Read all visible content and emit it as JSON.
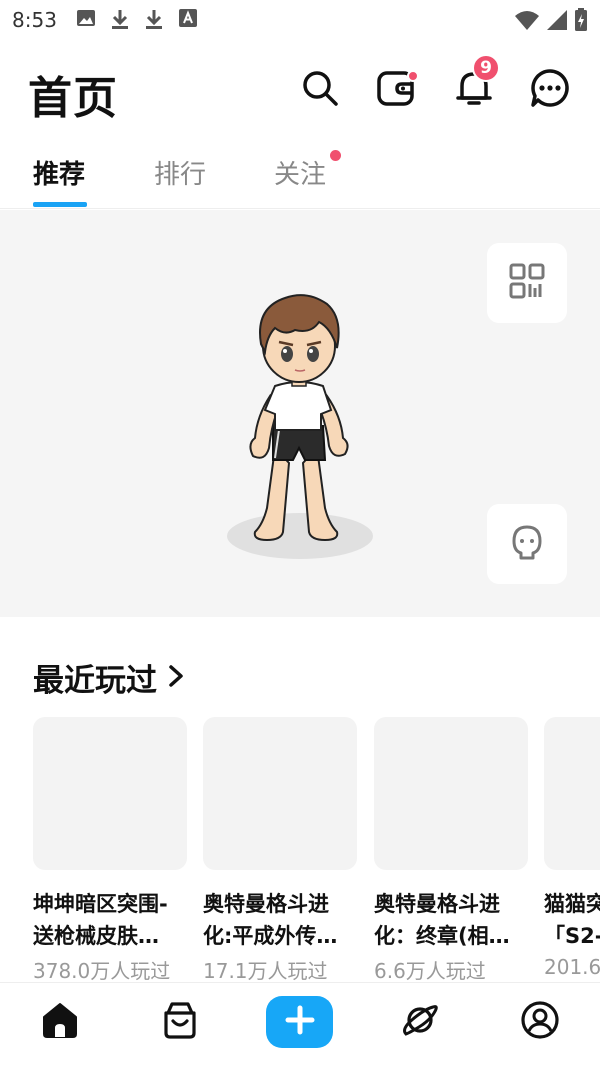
{
  "status": {
    "time": "8:53"
  },
  "header": {
    "title": "首页",
    "notification_count": "9"
  },
  "tabs": [
    {
      "label": "推荐",
      "active": true
    },
    {
      "label": "排行",
      "active": false
    },
    {
      "label": "关注",
      "active": false
    }
  ],
  "recent": {
    "title": "最近玩过",
    "items": [
      {
        "line1": "坤坤暗区突围-",
        "line2": "送枪械皮肤…",
        "plays": "378.0万人玩过"
      },
      {
        "line1": "奥特曼格斗进",
        "line2": "化:平成外传…",
        "plays": "17.1万人玩过"
      },
      {
        "line1": "奥特曼格斗进",
        "line2": "化：终章(相…",
        "plays": "6.6万人玩过"
      },
      {
        "line1": "猫猫突",
        "line2": "「S2-",
        "plays": "201.6"
      }
    ]
  },
  "colors": {
    "accent": "#17a7f7",
    "badge": "#f0506e"
  },
  "icons": [
    "search-icon",
    "wallet-icon",
    "bell-icon",
    "chat-icon",
    "qr-code-icon",
    "avatar-face-icon",
    "home-icon",
    "shop-bag-icon",
    "plus-icon",
    "planet-icon",
    "profile-icon"
  ]
}
